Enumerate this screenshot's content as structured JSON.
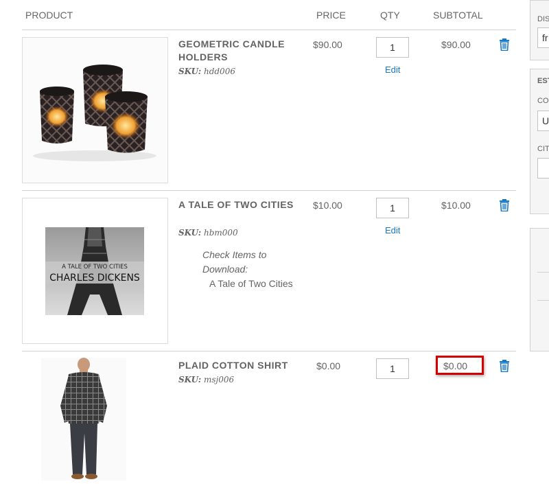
{
  "columns": {
    "product": "PRODUCT",
    "price": "PRICE",
    "qty": "QTY",
    "subtotal": "SUBTOTAL"
  },
  "items": [
    {
      "name": "GEOMETRIC CANDLE HOLDERS",
      "sku_label": "SKU:",
      "sku": "hdd006",
      "price": "$90.00",
      "qty": "1",
      "edit": "Edit",
      "subtotal": "$90.00"
    },
    {
      "name": "A TALE OF TWO CITIES",
      "sku_label": "SKU:",
      "sku": "hbm000",
      "price": "$10.00",
      "qty": "1",
      "edit": "Edit",
      "subtotal": "$10.00",
      "download_title": "Check Items to Download:",
      "download_item": "A Tale of Two Cities",
      "cover_title": "A TALE OF TWO CITIES",
      "cover_author": "CHARLES DICKENS"
    },
    {
      "name": "PLAID COTTON SHIRT",
      "sku_label": "SKU:",
      "sku": "msj006",
      "price": "$0.00",
      "qty": "1",
      "subtotal": "$0.00"
    }
  ],
  "sidebar": {
    "discount_label": "DIS",
    "discount_value": "fr",
    "estimate_title": "EST",
    "country_label": "CO",
    "country_value": "Ur",
    "city_label": "CIT"
  },
  "colors": {
    "link": "#1979c3",
    "highlight": "#d60000",
    "border": "#d1d1d1"
  }
}
